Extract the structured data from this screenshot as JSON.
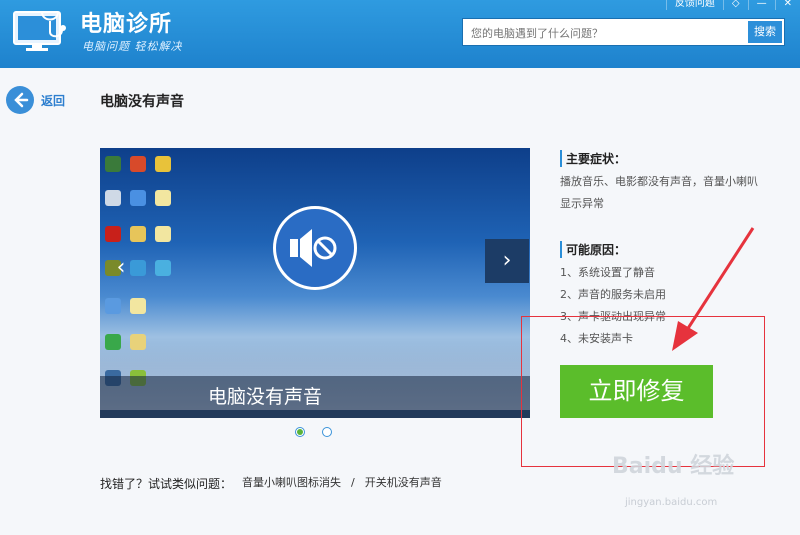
{
  "app": {
    "title": "电脑诊所",
    "subtitle": "电脑问题 轻松解决"
  },
  "window_controls": {
    "feedback": "反馈问题",
    "close": "✕"
  },
  "search": {
    "placeholder": "您的电脑遇到了什么问题？",
    "button": "搜索"
  },
  "nav": {
    "back_label": "返回"
  },
  "page": {
    "title": "电脑没有声音"
  },
  "slideshow": {
    "caption": "电脑没有声音",
    "slide_count": 2,
    "active_index": 0
  },
  "symptoms": {
    "title": "主要症状：",
    "text": "播放音乐、电影都没有声音，音量小喇叭显示异常"
  },
  "causes": {
    "title": "可能原因：",
    "items": [
      "1、系统设置了静音",
      "2、声音的服务未启用",
      "3、声卡驱动出现异常",
      "4、未安装声卡"
    ]
  },
  "fix_button": "立即修复",
  "similar": {
    "prompt": "找错了？试试类似问题：",
    "links": [
      "音量小喇叭图标消失",
      "开关机没有声音"
    ],
    "separator": "/"
  },
  "watermark": {
    "text": "Baidu 经验",
    "url": "jingyan.baidu.com"
  },
  "colors": {
    "header": "#1e82cd",
    "accent": "#2c8fd9",
    "fix_button": "#5bbd2b",
    "highlight_box": "#e6333d"
  }
}
